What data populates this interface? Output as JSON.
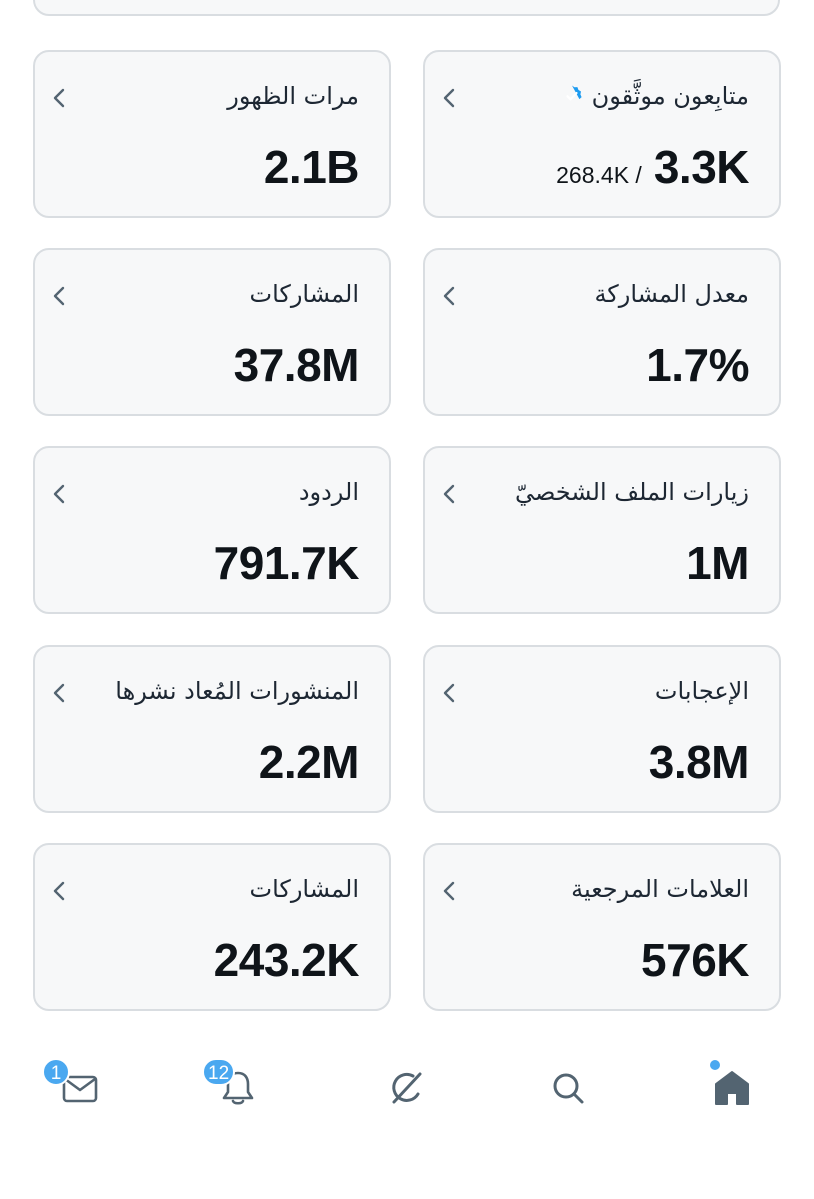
{
  "cards": [
    {
      "title": "متابِعون موثَّقون",
      "value": "3.3K",
      "subvalue": "268.4K /",
      "verified": true
    },
    {
      "title": "مرات الظهور",
      "value": "2.1B"
    },
    {
      "title": "معدل المشاركة",
      "value": "1.7%"
    },
    {
      "title": "المشاركات",
      "value": "37.8M"
    },
    {
      "title": "زيارات الملف الشخصيّ",
      "value": "1M"
    },
    {
      "title": "الردود",
      "value": "791.7K"
    },
    {
      "title": "الإعجابات",
      "value": "3.8M"
    },
    {
      "title": "المنشورات المُعاد نشرها",
      "value": "2.2M"
    },
    {
      "title": "العلامات المرجعية",
      "value": "576K"
    },
    {
      "title": "المشاركات",
      "value": "243.2K"
    }
  ],
  "nav": {
    "messages_badge": "1",
    "notifications_badge": "12"
  },
  "colors": {
    "accent": "#4aa8f0",
    "verified": "#1d9bf0",
    "card_bg": "#f7f8f9",
    "card_border": "#d9dde1"
  },
  "icons": [
    "chevron-left-icon",
    "verified-badge-icon",
    "home-icon",
    "search-icon",
    "grok-icon",
    "bell-icon",
    "mail-icon"
  ]
}
